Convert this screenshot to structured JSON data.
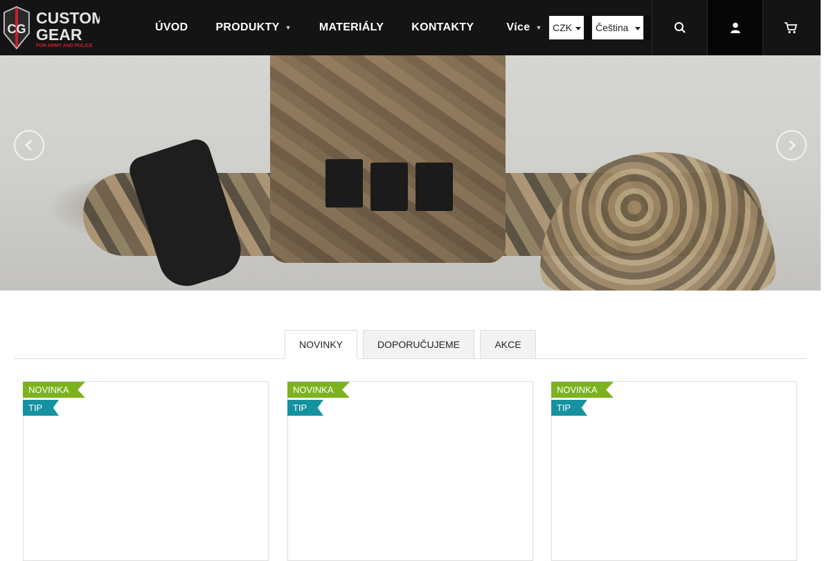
{
  "brand": {
    "logo_initials": "CG",
    "logo_word1": "CUSTOM",
    "logo_word2": "GEAR",
    "logo_tagline": "FOR ARMY AND POLICE"
  },
  "nav": {
    "items": [
      {
        "label": "ÚVOD"
      },
      {
        "label": "PRODUKTY"
      },
      {
        "label": "MATERIÁLY"
      },
      {
        "label": "KONTAKTY"
      }
    ],
    "more_label": "Více"
  },
  "currency": {
    "selected": "CZK"
  },
  "language": {
    "selected": "Čeština"
  },
  "header_icons": [
    "search-icon",
    "user-icon",
    "cart-icon"
  ],
  "tabs": [
    {
      "label": "NOVINKY",
      "active": true
    },
    {
      "label": "DOPORUČUJEME",
      "active": false
    },
    {
      "label": "AKCE",
      "active": false
    }
  ],
  "products": [
    {
      "flags": [
        "NOVINKA",
        "TIP"
      ]
    },
    {
      "flags": [
        "NOVINKA",
        "TIP"
      ]
    },
    {
      "flags": [
        "NOVINKA",
        "TIP"
      ]
    }
  ],
  "colors": {
    "header_bg": "#141414",
    "flag_new": "#7cb21e",
    "flag_tip": "#1591a0",
    "logo_red": "#c8202a"
  }
}
